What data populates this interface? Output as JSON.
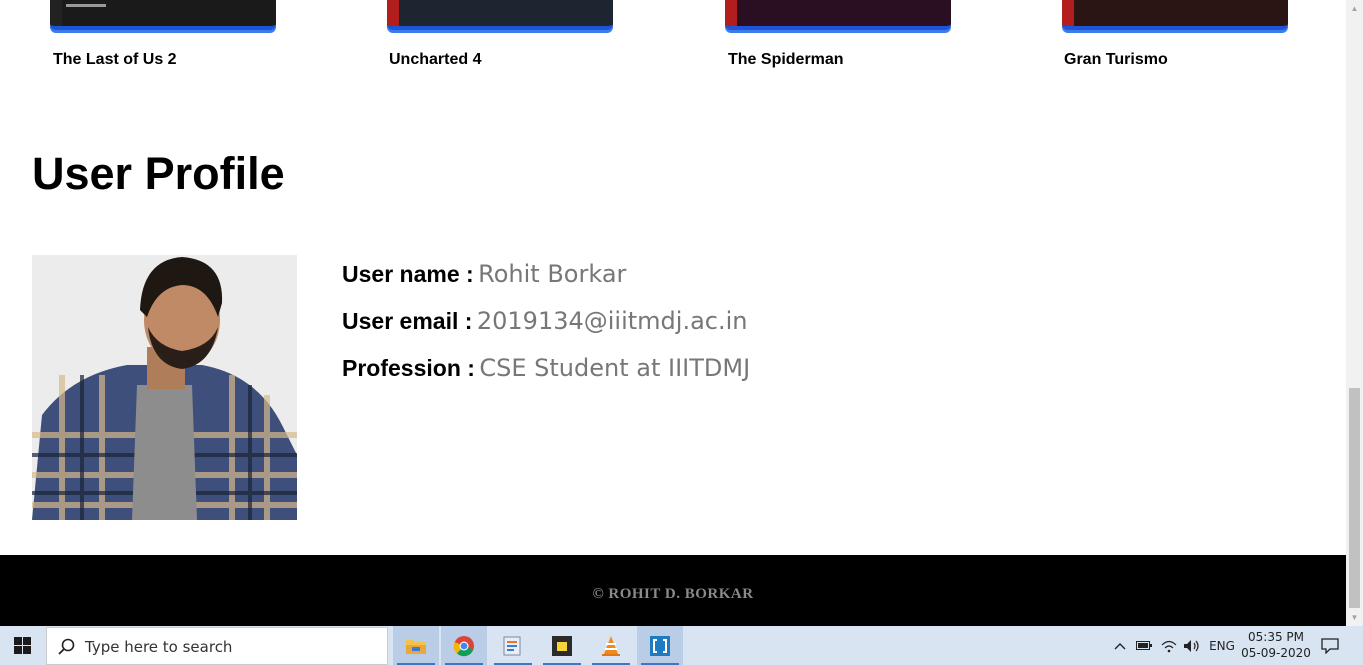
{
  "games": [
    {
      "title": "The Last of Us 2"
    },
    {
      "title": "Uncharted 4"
    },
    {
      "title": "The Spiderman"
    },
    {
      "title": "Gran Turismo"
    }
  ],
  "profile": {
    "heading": "User Profile",
    "fields": [
      {
        "label": "User name :",
        "value": "Rohit Borkar"
      },
      {
        "label": "User email :",
        "value": "2019134@iiitmdj.ac.in"
      },
      {
        "label": "Profession :",
        "value": "CSE Student at IIITDMJ"
      }
    ]
  },
  "footer": {
    "text": "© ROHIT D. BORKAR"
  },
  "taskbar": {
    "search_placeholder": "Type here to search",
    "apps": [
      "file-explorer",
      "chrome",
      "editor",
      "sticky-notes",
      "vlc",
      "brackets"
    ],
    "language": "ENG",
    "time": "05:35 PM",
    "date": "05-09-2020"
  },
  "colors": {
    "accent_blue": "#1f54d6",
    "footer_bg": "#000000",
    "value_gray": "#777777"
  }
}
